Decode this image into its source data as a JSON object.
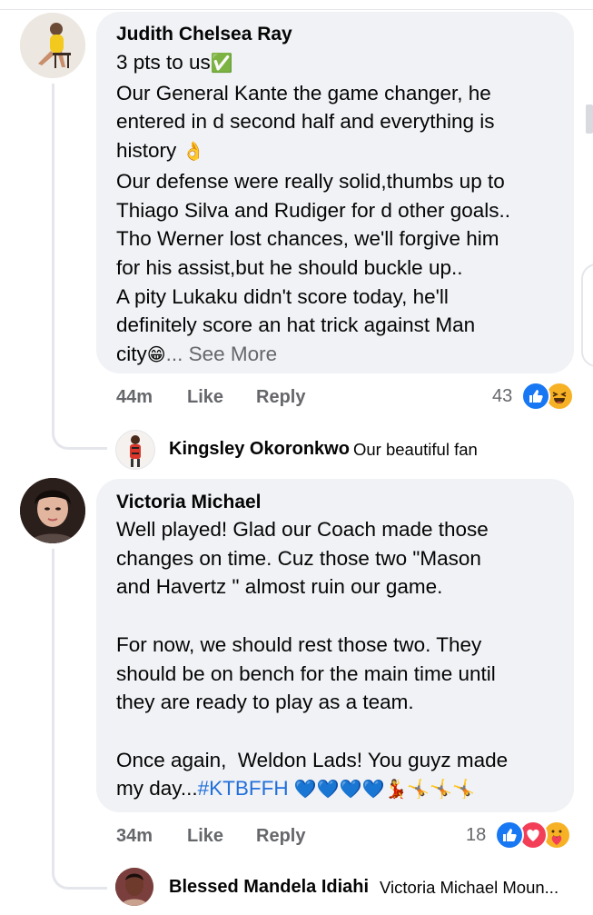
{
  "comments": [
    {
      "author": "Judith Chelsea Ray",
      "lines": [
        "3 pts to us",
        "Our General Kante the game changer, he",
        "entered in d second half and everything is",
        "history",
        "Our defense were really solid,thumbs up to",
        "Thiago Silva and Rudiger for d other goals..",
        "Tho Werner lost chances, we'll forgive him",
        "for his assist,but he should buckle up..",
        "A pity Lukaku didn't score today, he'll",
        "definitely score an hat trick against Man",
        "city"
      ],
      "see_more": "... See More",
      "time": "44m",
      "like_label": "Like",
      "reply_label": "Reply",
      "reaction_count": "43",
      "reactions": [
        "like-icon",
        "haha-icon"
      ],
      "reply": {
        "author": "Kingsley Okoronkwo",
        "text": "Our beautiful fan"
      }
    },
    {
      "author": "Victoria Michael",
      "lines": [
        "Well played! Glad our Coach made those",
        "changes on time. Cuz those two \"Mason",
        "and Havertz \" almost ruin our game.",
        "",
        "For now, we should rest those two. They",
        "should be on bench for the main time until",
        "they are ready to play as a team.",
        "",
        "Once again,  Weldon Lads! You guyz made",
        "my day..."
      ],
      "hashtag": "#KTBFFH",
      "emoji_tail": "💙💙💙💙💃🤸🤸🤸",
      "time": "34m",
      "like_label": "Like",
      "reply_label": "Reply",
      "reaction_count": "18",
      "reactions": [
        "like-icon",
        "love-icon",
        "care-icon"
      ],
      "reply": {
        "author": "Blessed Mandela Idiahi",
        "text": "Victoria Michael Moun..."
      }
    }
  ],
  "colors": {
    "bubble": "#f0f2f5",
    "link": "#216fdb",
    "muted": "#65676b",
    "like_blue": "#1877f2",
    "love_red": "#f33e58",
    "haha_yellow": "#f7b125"
  }
}
